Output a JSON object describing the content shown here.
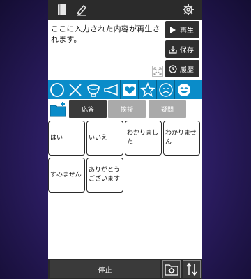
{
  "main_text": "ここに入力された内容が再生されます。",
  "side_buttons": {
    "play_label": "再生",
    "save_label": "保存",
    "history_label": "履歴"
  },
  "icons": {
    "top_left": [
      "book-icon",
      "pen-icon"
    ],
    "top_right": "gear-icon",
    "expand": "expand-icon",
    "symbols": [
      "circle-icon",
      "cross-icon",
      "bowl-icon",
      "horn-icon",
      "heart-icon",
      "star-icon",
      "sad-face-icon",
      "happy-face-icon"
    ],
    "folder": "folder-add-icon",
    "bottom": [
      "folder-settings-icon",
      "sort-arrows-icon"
    ]
  },
  "tabs": [
    {
      "label": "応答",
      "active": true
    },
    {
      "label": "挨拶",
      "active": false
    },
    {
      "label": "疑問",
      "active": false
    }
  ],
  "phrases": [
    "はい",
    "いいえ",
    "わかりました",
    "わかりません",
    "すみません",
    "ありがとうございます"
  ],
  "bottom": {
    "stop_label": "停止"
  },
  "colors": {
    "accent": "#0a8cc9",
    "dark": "#2b2b2b"
  }
}
